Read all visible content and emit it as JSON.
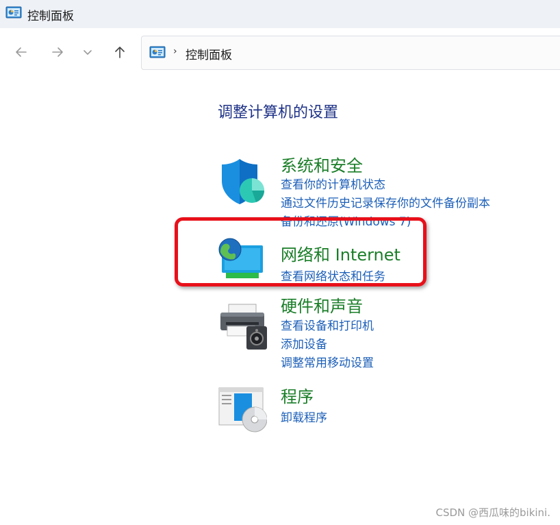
{
  "window": {
    "title": "控制面板"
  },
  "address": {
    "separator": "›",
    "crumb": "控制面板"
  },
  "nav": {
    "back": "back-arrow",
    "forward": "forward-arrow",
    "recent": "chevron-down",
    "up": "up-arrow"
  },
  "main": {
    "heading": "调整计算机的设置",
    "categories": [
      {
        "title": "系统和安全",
        "icon": "shield-icon",
        "links": [
          "查看你的计算机状态",
          "通过文件历史记录保存你的文件备份副本",
          "备份和还原(Windows 7)"
        ]
      },
      {
        "title": "网络和 Internet",
        "icon": "network-globe-icon",
        "links": [
          "查看网络状态和任务"
        ]
      },
      {
        "title": "硬件和声音",
        "icon": "printer-speaker-icon",
        "links": [
          "查看设备和打印机",
          "添加设备",
          "调整常用移动设置"
        ]
      },
      {
        "title": "程序",
        "icon": "programs-disc-icon",
        "links": [
          "卸载程序"
        ]
      }
    ]
  },
  "watermark": "CSDN @西瓜味的bikini.",
  "colors": {
    "title_green": "#1a7e28",
    "link_blue": "#1c5fb8",
    "heading_blue": "#1e3287",
    "highlight_red": "#e8101a"
  }
}
